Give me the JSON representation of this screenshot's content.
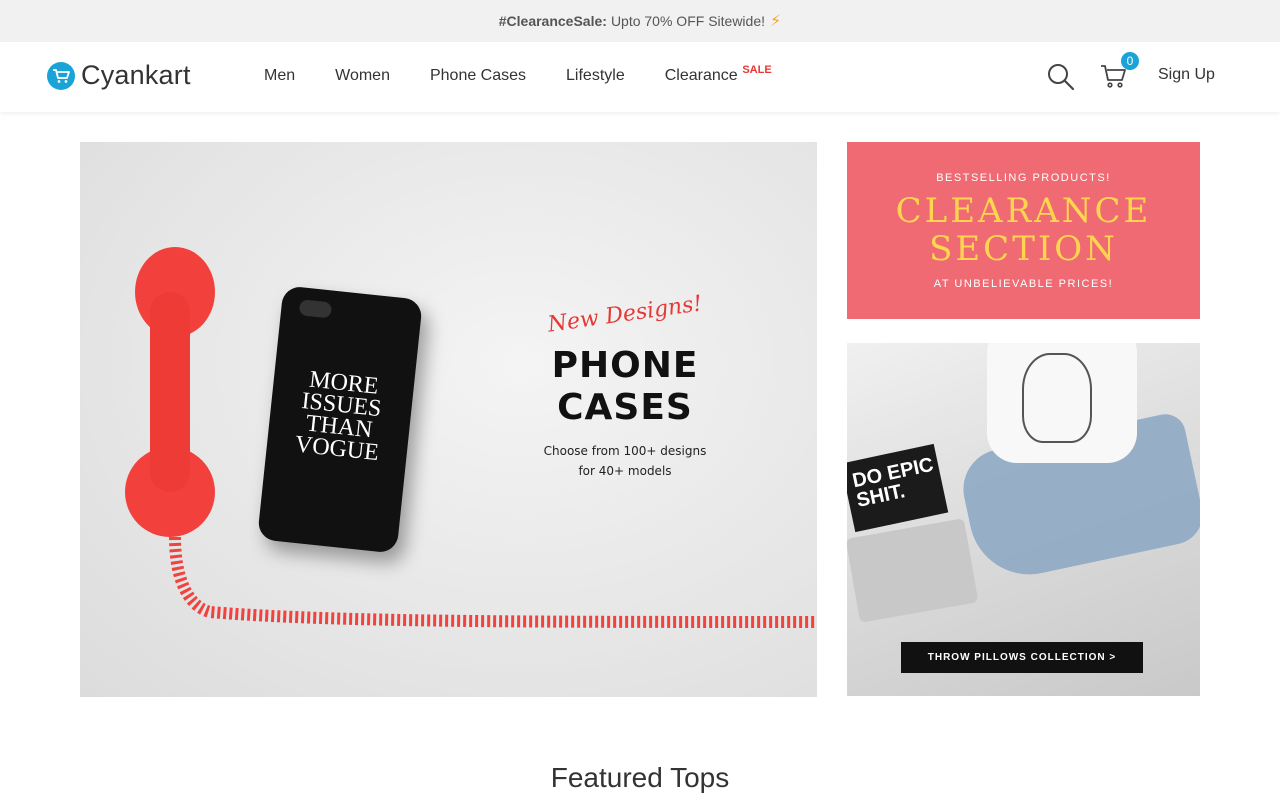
{
  "announcement": {
    "hashtag": "#ClearanceSale:",
    "message": "Upto 70% OFF Sitewide!",
    "icon": "lightning-icon"
  },
  "header": {
    "brand": "Cyankart",
    "brand_color": "#1aa3d6",
    "nav": [
      {
        "label": "Men"
      },
      {
        "label": "Women"
      },
      {
        "label": "Phone Cases"
      },
      {
        "label": "Lifestyle"
      },
      {
        "label": "Clearance",
        "badge": "SALE"
      }
    ],
    "cart_count": "0",
    "signup_label": "Sign Up",
    "search_icon": "search-icon",
    "cart_icon": "cart-icon"
  },
  "hero": {
    "tagline": "New Designs!",
    "title_line1": "PHONE",
    "title_line2": "CASES",
    "sub_line1": "Choose from 100+ designs",
    "sub_line2": "for 40+ models",
    "case_text": "MORE ISSUES THAN VOGUE"
  },
  "promo_clearance": {
    "top": "BESTSELLING PRODUCTS!",
    "title_line1": "CLEARANCE",
    "title_line2": "SECTION",
    "bottom": "AT UNBELIEVABLE PRICES!",
    "bg_color": "#ef6a72",
    "title_color": "#ffd54f"
  },
  "promo_pillows": {
    "book_text": "DO EPIC SHIT.",
    "cta": "THROW PILLOWS COLLECTION >"
  },
  "section": {
    "title": "Featured Tops"
  }
}
